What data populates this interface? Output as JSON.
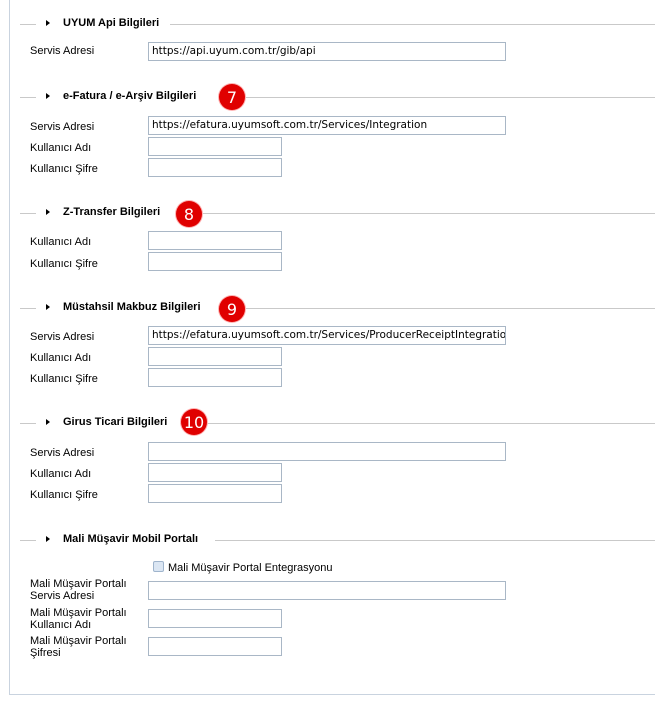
{
  "sections": {
    "uyum_api": {
      "title": "UYUM Api Bilgileri",
      "servis_label": "Servis Adresi",
      "servis_value": "https://api.uyum.com.tr/gib/api"
    },
    "efatura": {
      "title": "e-Fatura / e-Arşiv Bilgileri",
      "badge": "7",
      "servis_label": "Servis Adresi",
      "servis_value": "https://efatura.uyumsoft.com.tr/Services/Integration",
      "kullanici_label": "Kullanıcı Adı",
      "kullanici_value": "",
      "sifre_label": "Kullanıcı Şifre",
      "sifre_value": ""
    },
    "ztransfer": {
      "title": "Z-Transfer Bilgileri",
      "badge": "8",
      "kullanici_label": "Kullanıcı Adı",
      "kullanici_value": "",
      "sifre_label": "Kullanıcı Şifre",
      "sifre_value": ""
    },
    "mustahsil": {
      "title": "Müstahsil Makbuz Bilgileri",
      "badge": "9",
      "servis_label": "Servis Adresi",
      "servis_value": "https://efatura.uyumsoft.com.tr/Services/ProducerReceiptIntegration",
      "kullanici_label": "Kullanıcı Adı",
      "kullanici_value": "",
      "sifre_label": "Kullanıcı Şifre",
      "sifre_value": ""
    },
    "girus": {
      "title": "Girus Ticari Bilgileri",
      "badge": "10",
      "servis_label": "Servis Adresi",
      "servis_value": "",
      "kullanici_label": "Kullanıcı Adı",
      "kullanici_value": "",
      "sifre_label": "Kullanıcı Şifre",
      "sifre_value": ""
    },
    "mali_musavir": {
      "title": "Mali Müşavir Mobil Portalı",
      "checkbox_label": "Mali Müşavir Portal Entegrasyonu",
      "checkbox_checked": false,
      "servis_label": "Mali Müşavir Portalı Servis Adresi",
      "servis_value": "",
      "kullanici_label": "Mali Müşavir Portalı Kullanıcı Adı",
      "kullanici_value": "",
      "sifre_label": "Mali Müşavir Portalı Şifresi",
      "sifre_value": ""
    }
  },
  "colors": {
    "badge": "#e00000",
    "input_border": "#a9b7c6",
    "separator": "#c9c9c9"
  }
}
